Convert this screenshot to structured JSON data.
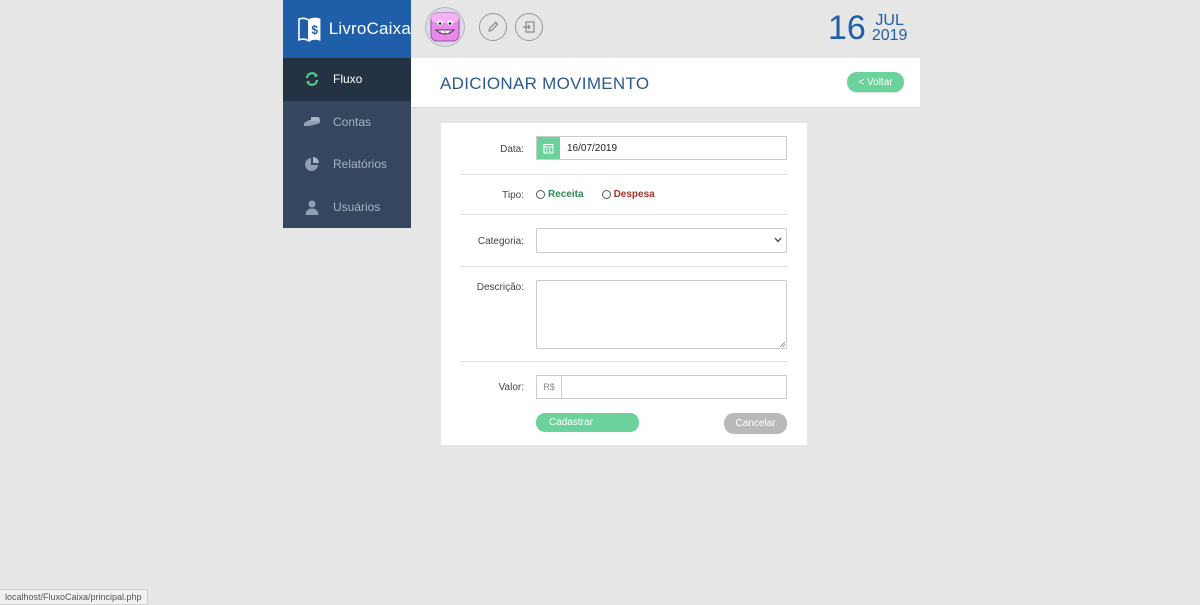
{
  "app": {
    "name": "LivroCaixa"
  },
  "sidebar": {
    "items": [
      {
        "label": "Fluxo",
        "active": true
      },
      {
        "label": "Contas",
        "active": false
      },
      {
        "label": "Relatórios",
        "active": false
      },
      {
        "label": "Usuários",
        "active": false
      }
    ]
  },
  "topbar": {
    "date": {
      "day": "16",
      "month": "JUL",
      "year": "2019"
    }
  },
  "header": {
    "title": "ADICIONAR MOVIMENTO",
    "back_label": "< Voltar"
  },
  "form": {
    "data": {
      "label": "Data:",
      "value": "16/07/2019"
    },
    "tipo": {
      "label": "Tipo:",
      "options": [
        "Receita",
        "Despesa"
      ]
    },
    "categoria": {
      "label": "Categoria:",
      "value": ""
    },
    "descricao": {
      "label": "Descrição:",
      "value": ""
    },
    "valor": {
      "label": "Valor:",
      "prefix": "R$",
      "value": ""
    },
    "submit_label": "Cadastrar",
    "cancel_label": "Cancelar"
  },
  "statusbar": {
    "url": "localhost/FluxoCaixa/principal.php"
  },
  "colors": {
    "brand_blue": "#1f5ea8",
    "sidebar_bg": "#34475e",
    "accent_green": "#6ad29a",
    "receita": "#2e8b57",
    "despesa": "#a8322a"
  }
}
